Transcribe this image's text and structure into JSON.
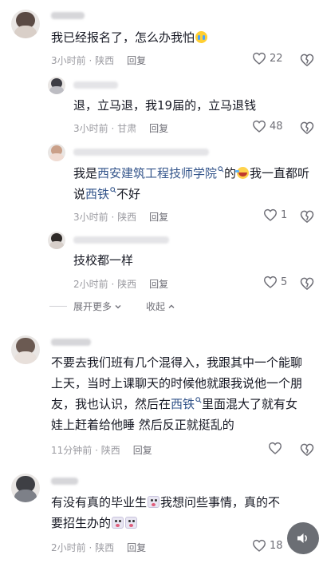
{
  "comments": [
    {
      "text": "我已经报名了，怎么办我怕",
      "location_time": "3小时前 · 陕西",
      "reply_label": "回复",
      "likes": "22",
      "replies": [
        {
          "text": "退，立马退，我19届的，立马退钱",
          "location_time": "3小时前 · 甘肃",
          "reply_label": "回复",
          "likes": "48"
        },
        {
          "text_pre": "我是",
          "link1": "西安建筑工程技师学院",
          "text_mid1": "的",
          "text_mid2": "我一直都听说",
          "link2": "西铁",
          "text_post": "不好",
          "location_time": "3小时前 · 陕西",
          "reply_label": "回复",
          "likes": "1"
        },
        {
          "text": "技校都一样",
          "location_time": "2小时前 · 陕西",
          "reply_label": "回复",
          "likes": "5"
        }
      ],
      "expand_more": "展开更多",
      "collapse": "收起"
    },
    {
      "text_pre": "不要去我们班有几个混得入，我跟其中一个能聊上天，当时上课聊天的时候他就跟我说他一个朋友，我也认识，然后在",
      "link": "西铁",
      "text_post": "里面混大了就有女娃上赶着给他睡 然后反正就挺乱的",
      "location_time": "11分钟前 · 陕西",
      "reply_label": "回复",
      "likes": ""
    },
    {
      "text_pre": "有没有真的毕业生",
      "text_mid": "我想问些事情，真的不要招生办的",
      "location_time": "2小时前 · 陕西",
      "reply_label": "回复",
      "likes": "18"
    }
  ],
  "icons": {
    "heart": "heart-icon",
    "dislike": "dislike-icon",
    "search": "search-icon",
    "sound": "speaker-icon"
  },
  "colors": {
    "link": "#34558b",
    "meta": "#9b9ba1",
    "text": "#161823"
  }
}
